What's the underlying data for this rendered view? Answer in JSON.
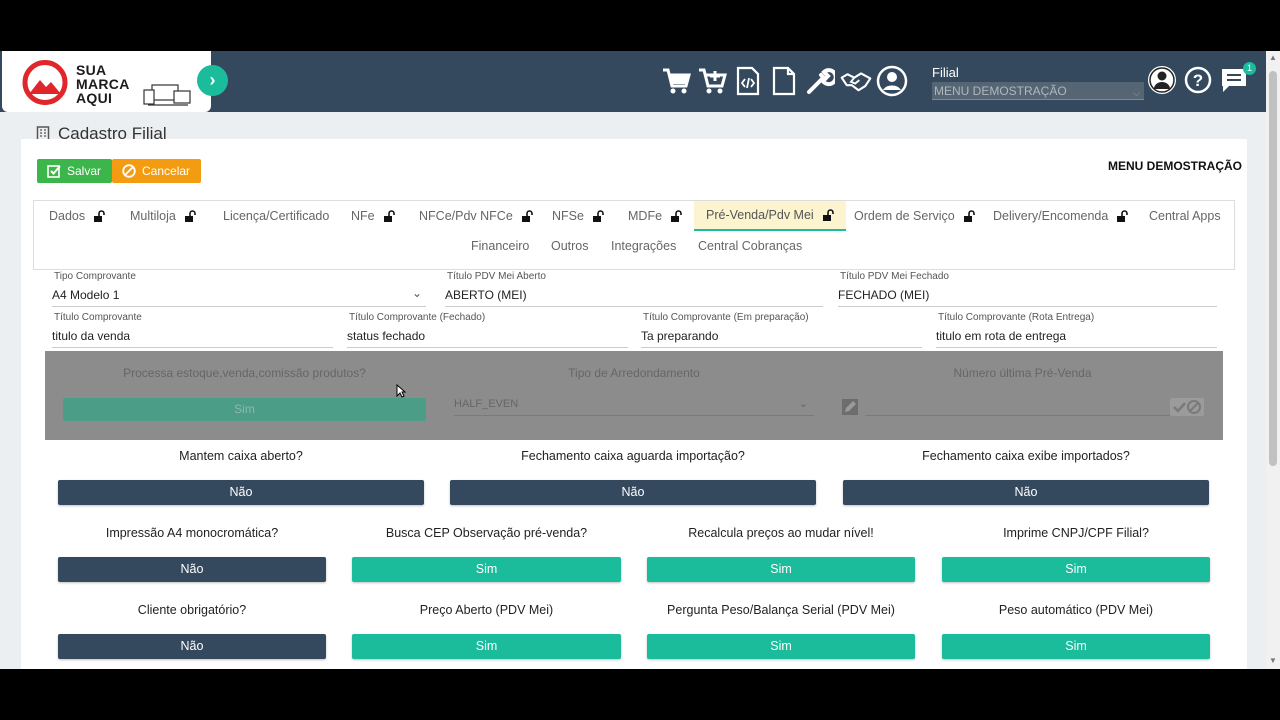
{
  "brand": {
    "line1": "SUA",
    "line2": "MARCA",
    "line3": "AQUI"
  },
  "header": {
    "filial_label": "Filial",
    "filial_value": "MENU DEMOSTRAÇÃO",
    "notification_count": "1",
    "icons": [
      "cart-icon",
      "cart-plus-icon",
      "file-code-icon",
      "file-icon",
      "wrench-icon",
      "handshake-icon",
      "user-circle-icon",
      "user-icon",
      "help-icon",
      "chat-icon"
    ]
  },
  "page": {
    "title": "Cadastro Filial",
    "save_label": "Salvar",
    "cancel_label": "Cancelar",
    "company": "MENU DEMOSTRAÇÃO"
  },
  "tabs": {
    "row1": [
      {
        "label": "Dados",
        "locked": true
      },
      {
        "label": "Multiloja",
        "locked": true
      },
      {
        "label": "Licença/Certificado",
        "locked": false
      },
      {
        "label": "NFe",
        "locked": true
      },
      {
        "label": "NFCe/Pdv NFCe",
        "locked": true
      },
      {
        "label": "NFSe",
        "locked": true
      },
      {
        "label": "MDFe",
        "locked": true
      },
      {
        "label": "Pré-Venda/Pdv Mei",
        "locked": true,
        "active": true
      },
      {
        "label": "Ordem de Serviço",
        "locked": true
      },
      {
        "label": "Delivery/Encomenda",
        "locked": true
      },
      {
        "label": "Central Apps",
        "locked": false
      }
    ],
    "row2": [
      "Financeiro",
      "Outros",
      "Integrações",
      "Central Cobranças"
    ]
  },
  "fields": {
    "tipo_comprovante": {
      "label": "Tipo Comprovante",
      "value": "A4 Modelo 1"
    },
    "titulo_aberto": {
      "label": "Título PDV Mei Aberto",
      "value": "ABERTO (MEI)"
    },
    "titulo_fechado": {
      "label": "Título PDV Mei Fechado",
      "value": "FECHADO (MEI)"
    },
    "titulo_comprovante": {
      "label": "Título Comprovante",
      "value": "titulo da venda"
    },
    "titulo_comp_fechado": {
      "label": "Título Comprovante (Fechado)",
      "value": "status fechado"
    },
    "titulo_comp_preparacao": {
      "label": "Título Comprovante (Em preparação)",
      "value": "Ta preparando"
    },
    "titulo_comp_rota": {
      "label": "Título Comprovante (Rota Entrega)",
      "value": "titulo em rota de entrega"
    }
  },
  "disabled": {
    "q1": "Processa estoque,venda,comissão produtos?",
    "q1_value": "Sim",
    "q2": "Tipo de Arredondamento",
    "q2_value": "HALF_EVEN",
    "q3": "Número última Pré-Venda"
  },
  "toggles3": [
    {
      "label": "Mantem caixa aberto?",
      "value": "Não"
    },
    {
      "label": "Fechamento caixa aguarda importação?",
      "value": "Não"
    },
    {
      "label": "Fechamento caixa exibe importados?",
      "value": "Não"
    }
  ],
  "toggles4a": [
    {
      "label": "Impressão A4 monocromática?",
      "value": "Não"
    },
    {
      "label": "Busca CEP Observação pré-venda?",
      "value": "Sim"
    },
    {
      "label": "Recalcula preços ao mudar nível!",
      "value": "Sim"
    },
    {
      "label": "Imprime CNPJ/CPF Filial?",
      "value": "Sim"
    }
  ],
  "toggles4b": [
    {
      "label": "Cliente obrigatório?",
      "value": "Não"
    },
    {
      "label": "Preço Aberto (PDV Mei)",
      "value": "Sim"
    },
    {
      "label": "Pergunta Peso/Balança Serial (PDV Mei)",
      "value": "Sim"
    },
    {
      "label": "Peso automático (PDV Mei)",
      "value": "Sim"
    }
  ],
  "colors": {
    "topbar": "#34495e",
    "accent": "#1abc9c",
    "save": "#3cb54a",
    "cancel": "#f39c12",
    "no": "#34495e"
  }
}
